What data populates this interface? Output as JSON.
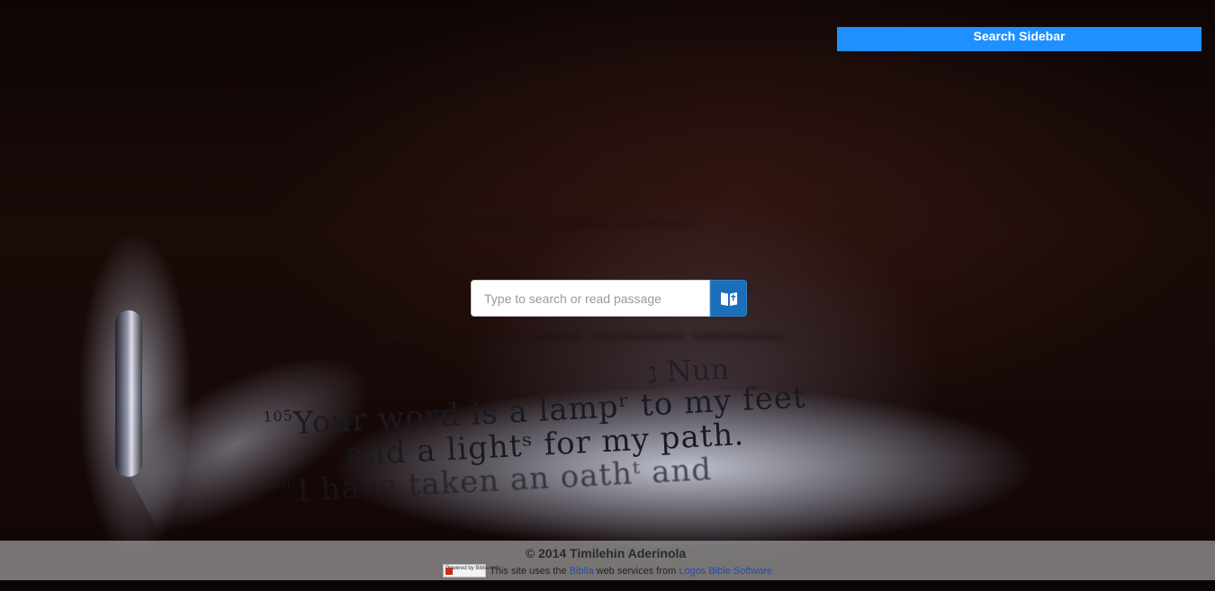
{
  "sidebar": {
    "button_label": "Search Sidebar"
  },
  "search": {
    "placeholder": "Type to search or read passage"
  },
  "scripture": {
    "heading": "נ Nun",
    "verse_105_num": "105",
    "verse_105_line1": "Your word is a lampʳ to my feet",
    "verse_105_line2": "and a lightˢ for my path.",
    "verse_106_num": "106",
    "verse_106_line1": "I have taken an oathᵗ and"
  },
  "footer": {
    "copyright": "© 2014 Timilehin Aderinola",
    "logo_text": "Powered by Biblia.com",
    "attribution_prefix": "This site uses the",
    "biblia_link": "Biblia",
    "attribution_middle": "web services from",
    "logos_link": "Logos Bible Software"
  },
  "colors": {
    "sidebar_button": "#1e90ff",
    "search_button": "#1b6fb8",
    "footer_bg": "#a0a0a0"
  },
  "icons": {
    "search_button": "open-book-icon"
  }
}
